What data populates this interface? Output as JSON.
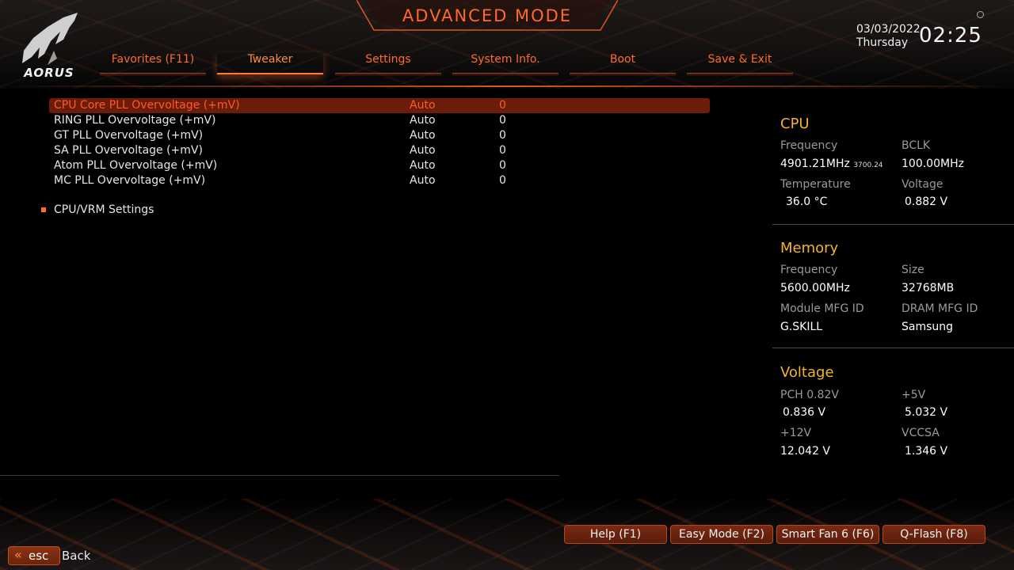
{
  "header": {
    "title": "ADVANCED MODE",
    "logo_text": "AORUS",
    "date": "03/03/2022",
    "day": "Thursday",
    "time": "02:25"
  },
  "tabs": [
    {
      "label": "Favorites (F11)",
      "active": false
    },
    {
      "label": "Tweaker",
      "active": true
    },
    {
      "label": "Settings",
      "active": false
    },
    {
      "label": "System Info.",
      "active": false
    },
    {
      "label": "Boot",
      "active": false
    },
    {
      "label": "Save & Exit",
      "active": false
    }
  ],
  "settings": [
    {
      "name": "CPU Core PLL Overvoltage (+mV)",
      "mode": "Auto",
      "value": "0",
      "selected": true
    },
    {
      "name": "RING PLL Overvoltage (+mV)",
      "mode": "Auto",
      "value": "0",
      "selected": false
    },
    {
      "name": "GT PLL Overvoltage (+mV)",
      "mode": "Auto",
      "value": "0",
      "selected": false
    },
    {
      "name": "SA PLL Overvoltage (+mV)",
      "mode": "Auto",
      "value": "0",
      "selected": false
    },
    {
      "name": "Atom PLL Overvoltage (+mV)",
      "mode": "Auto",
      "value": "0",
      "selected": false
    },
    {
      "name": "MC PLL Overvoltage (+mV)",
      "mode": "Auto",
      "value": "0",
      "selected": false
    }
  ],
  "submenu": {
    "label": "CPU/VRM Settings"
  },
  "panel": {
    "cpu": {
      "title": "CPU",
      "freq_label": "Frequency",
      "freq_value": "4901.21MHz",
      "freq_sub": "3700.24",
      "bclk_label": "BCLK",
      "bclk_value": "100.00MHz",
      "temp_label": "Temperature",
      "temp_value": "36.0 °C",
      "volt_label": "Voltage",
      "volt_value": "0.882 V"
    },
    "memory": {
      "title": "Memory",
      "freq_label": "Frequency",
      "freq_value": "5600.00MHz",
      "size_label": "Size",
      "size_value": "32768MB",
      "module_label": "Module MFG ID",
      "module_value": "G.SKILL",
      "dram_label": "DRAM MFG ID",
      "dram_value": "Samsung"
    },
    "voltage": {
      "title": "Voltage",
      "pch_label": "PCH 0.82V",
      "pch_value": "0.836 V",
      "p5_label": "+5V",
      "p5_value": "5.032 V",
      "p12_label": "+12V",
      "p12_value": "12.042 V",
      "vccsa_label": "VCCSA",
      "vccsa_value": "1.346 V"
    }
  },
  "footer": {
    "help": "Help (F1)",
    "easy_mode": "Easy Mode (F2)",
    "smart_fan": "Smart Fan 6 (F6)",
    "qflash": "Q-Flash (F8)",
    "esc_label": "esc",
    "esc_chevron": "«",
    "back_label": "Back"
  },
  "colors": {
    "accent": "#ff6a2a",
    "section_title": "#f2b233",
    "selected_row_bg": "#6b1c0a"
  }
}
